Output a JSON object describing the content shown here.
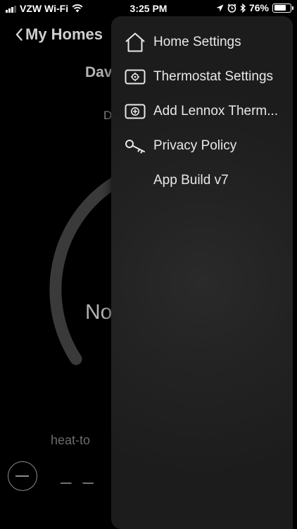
{
  "status_bar": {
    "carrier": "VZW Wi-Fi",
    "time": "3:25 PM",
    "battery_percent": "76%",
    "battery_level": 0.76
  },
  "header": {
    "back_label": "My Homes"
  },
  "background": {
    "home_name_fragment": "Dav",
    "day_fragment": "D",
    "mode_fragment": "No",
    "heat_label": "heat-to",
    "heat_value": "– –"
  },
  "menu": {
    "items": [
      {
        "label": "Home Settings",
        "icon": "house-icon"
      },
      {
        "label": "Thermostat Settings",
        "icon": "thermostat-gear-icon"
      },
      {
        "label": "Add Lennox Therm...",
        "icon": "add-thermostat-icon"
      },
      {
        "label": "Privacy Policy",
        "icon": "key-icon"
      },
      {
        "label": "App Build v7",
        "icon": ""
      }
    ]
  }
}
